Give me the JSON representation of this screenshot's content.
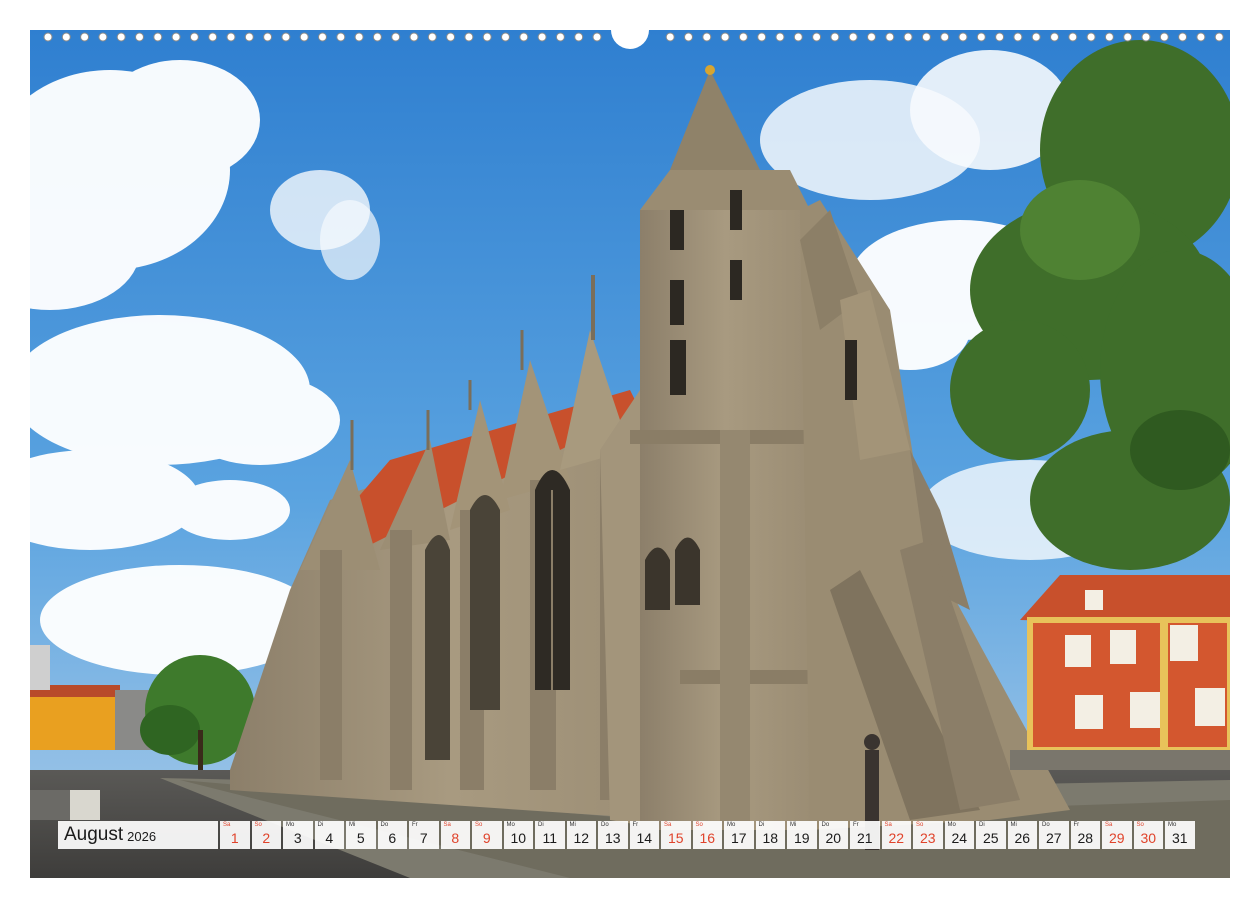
{
  "calendar": {
    "month": "August",
    "year": "2026",
    "days": [
      {
        "wd": "Sa",
        "num": "1",
        "weekend": true
      },
      {
        "wd": "So",
        "num": "2",
        "weekend": true
      },
      {
        "wd": "Mo",
        "num": "3",
        "weekend": false
      },
      {
        "wd": "Di",
        "num": "4",
        "weekend": false
      },
      {
        "wd": "Mi",
        "num": "5",
        "weekend": false
      },
      {
        "wd": "Do",
        "num": "6",
        "weekend": false
      },
      {
        "wd": "Fr",
        "num": "7",
        "weekend": false
      },
      {
        "wd": "Sa",
        "num": "8",
        "weekend": true
      },
      {
        "wd": "So",
        "num": "9",
        "weekend": true
      },
      {
        "wd": "Mo",
        "num": "10",
        "weekend": false
      },
      {
        "wd": "Di",
        "num": "11",
        "weekend": false
      },
      {
        "wd": "Mi",
        "num": "12",
        "weekend": false
      },
      {
        "wd": "Do",
        "num": "13",
        "weekend": false
      },
      {
        "wd": "Fr",
        "num": "14",
        "weekend": false
      },
      {
        "wd": "Sa",
        "num": "15",
        "weekend": true
      },
      {
        "wd": "So",
        "num": "16",
        "weekend": true
      },
      {
        "wd": "Mo",
        "num": "17",
        "weekend": false
      },
      {
        "wd": "Di",
        "num": "18",
        "weekend": false
      },
      {
        "wd": "Mi",
        "num": "19",
        "weekend": false
      },
      {
        "wd": "Do",
        "num": "20",
        "weekend": false
      },
      {
        "wd": "Fr",
        "num": "21",
        "weekend": false
      },
      {
        "wd": "Sa",
        "num": "22",
        "weekend": true
      },
      {
        "wd": "So",
        "num": "23",
        "weekend": true
      },
      {
        "wd": "Mo",
        "num": "24",
        "weekend": false
      },
      {
        "wd": "Di",
        "num": "25",
        "weekend": false
      },
      {
        "wd": "Mi",
        "num": "26",
        "weekend": false
      },
      {
        "wd": "Do",
        "num": "27",
        "weekend": false
      },
      {
        "wd": "Fr",
        "num": "28",
        "weekend": false
      },
      {
        "wd": "Sa",
        "num": "29",
        "weekend": true
      },
      {
        "wd": "So",
        "num": "30",
        "weekend": true
      },
      {
        "wd": "Mo",
        "num": "31",
        "weekend": false
      }
    ]
  },
  "colors": {
    "weekend": "#e0432b",
    "sky": "#3f8fd8",
    "stone": "#a99a80",
    "roof": "#c8502c",
    "tree": "#3f6e2a"
  }
}
